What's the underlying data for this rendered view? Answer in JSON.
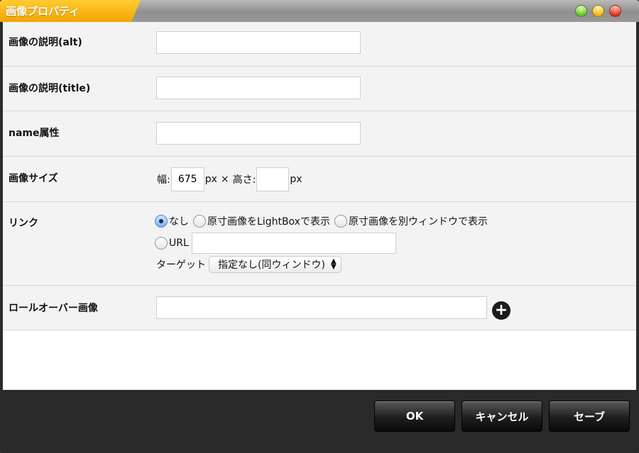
{
  "window": {
    "title": "画像プロパティ"
  },
  "fields": {
    "alt": {
      "label": "画像の説明(alt)",
      "value": ""
    },
    "title": {
      "label": "画像の説明(title)",
      "value": ""
    },
    "name": {
      "label": "name属性",
      "value": ""
    },
    "size": {
      "label": "画像サイズ",
      "width_label": "幅:",
      "width_value": "675",
      "unit1": "px",
      "times": "×",
      "height_label": "高さ:",
      "height_value": "",
      "unit2": "px"
    },
    "link": {
      "label": "リンク",
      "options": [
        "なし",
        "原寸画像をLightBoxで表示",
        "原寸画像を別ウィンドウで表示"
      ],
      "selected": "なし",
      "url_label": "URL",
      "url_value": "",
      "target_label": "ターゲット",
      "target_value": "指定なし(同ウィンドウ)"
    },
    "rollover": {
      "label": "ロールオーバー画像",
      "value": "",
      "add_icon": "plus-icon"
    }
  },
  "footer": {
    "ok_label": "OK",
    "cancel_label": "キャンセル",
    "save_label": "セーブ"
  },
  "colors": {
    "title_tab": "#f2a500",
    "row_bg": "#f3f3f3",
    "footer_bg": "#2a2a2a"
  }
}
